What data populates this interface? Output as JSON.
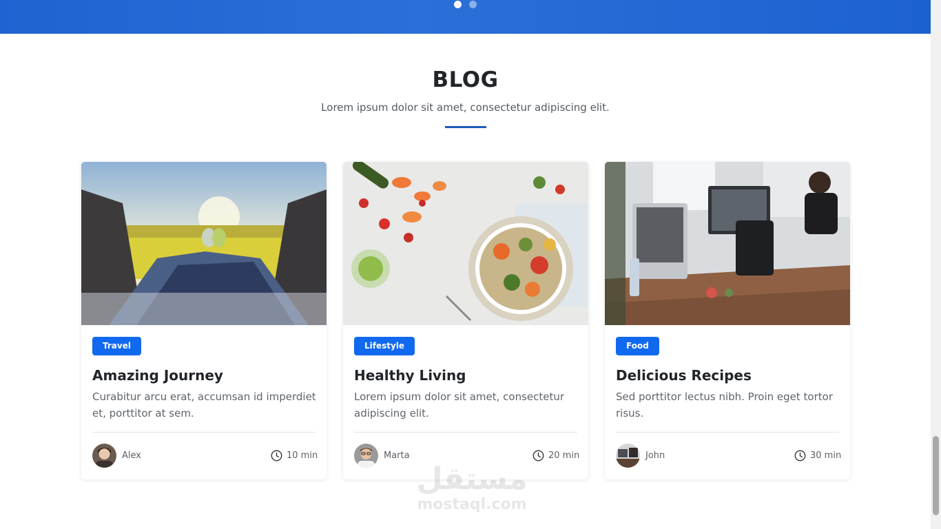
{
  "carousel": {
    "slides": 2,
    "active": 1
  },
  "blog": {
    "title": "BLOG",
    "subtitle": "Lorem ipsum dolor sit amet, consectetur adipiscing elit."
  },
  "cards": [
    {
      "tag": "Travel",
      "title": "Amazing Journey",
      "text": "Curabitur arcu erat, accumsan id imperdiet et, porttitor at sem.",
      "author": "Alex",
      "time": "10 min",
      "image": "travel-photo"
    },
    {
      "tag": "Lifestyle",
      "title": "Healthy Living",
      "text": "Lorem ipsum dolor sit amet, consectetur adipiscing elit.",
      "author": "Marta",
      "time": "20 min",
      "image": "food-bowl-photo"
    },
    {
      "tag": "Food",
      "title": "Delicious Recipes",
      "text": "Sed porttitor lectus nibh. Proin eget tortor risus.",
      "author": "John",
      "time": "30 min",
      "image": "office-photo"
    }
  ],
  "watermark": {
    "arabic": "مستقل",
    "latin": "mostaql.com"
  },
  "colors": {
    "accent": "#1169ef",
    "hero": "#2468d6",
    "divider": "#1d5bb8"
  }
}
